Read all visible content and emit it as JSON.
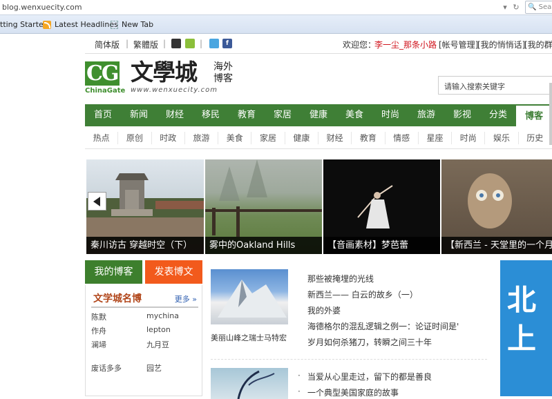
{
  "browser": {
    "url": "blog.wenxuecity.com",
    "search_placeholder": "Sea",
    "bookmarks": [
      "tting Started",
      "Latest Headlines",
      "New Tab"
    ]
  },
  "topbar": {
    "lang_simplified": "简体版",
    "lang_traditional": "繁體版",
    "welcome": "欢迎您：",
    "username": "李一尘_那条小路",
    "links": [
      "[帐号管理]",
      "[我的悄悄话]",
      "[我的群"
    ]
  },
  "logo": {
    "cg": "CG",
    "chinagate": "ChinaGate",
    "name": "文學城",
    "url": "www.wenxuecity.com",
    "tag1": "海外",
    "tag2": "博客"
  },
  "search": {
    "placeholder": "请输入搜索关键字"
  },
  "nav_main": [
    "首页",
    "新闻",
    "财经",
    "移民",
    "教育",
    "家居",
    "健康",
    "美食",
    "时尚",
    "旅游",
    "影视",
    "分类",
    "博客"
  ],
  "nav_sub": [
    "热点",
    "原创",
    "时政",
    "旅游",
    "美食",
    "家居",
    "健康",
    "财经",
    "教育",
    "情感",
    "星座",
    "时尚",
    "娱乐",
    "历史"
  ],
  "carousel": [
    {
      "caption": "秦川访古 穿越时空（下）"
    },
    {
      "caption": "雾中的Oakland Hills"
    },
    {
      "caption": "【音画素材】梦芭蕾"
    },
    {
      "caption": "【新西兰 - 天堂里的一个月"
    }
  ],
  "left": {
    "my_blog": "我的博客",
    "post_blog": "发表博文",
    "famous_title": "文学城名博",
    "more": "更多 »",
    "names": [
      [
        "陈默",
        "mychina"
      ],
      [
        "作舟",
        "lepton"
      ],
      [
        "澜埽",
        "九月豆"
      ],
      [
        "废话多多",
        "园艺"
      ]
    ]
  },
  "main": {
    "thumb1_caption": "美丽山峰之瑞士马特宏",
    "list1": [
      "那些被掩埋的光线",
      "新西兰—— 白云的故乡（一）",
      "我的外婆",
      "海德格尔的混乱逻辑之例一：论证时间是'",
      "岁月如何杀猪刀，转瞬之间三十年"
    ],
    "list2": [
      "当爱从心里走过，留下的都是善良",
      "一个典型美国家庭的故事"
    ]
  },
  "ad": {
    "text": "北 上"
  },
  "colors": {
    "nav_green": "#3f7f36",
    "blog_green": "#3d7f2d",
    "post_orange": "#f25a1c",
    "user_red": "#d0121b"
  }
}
